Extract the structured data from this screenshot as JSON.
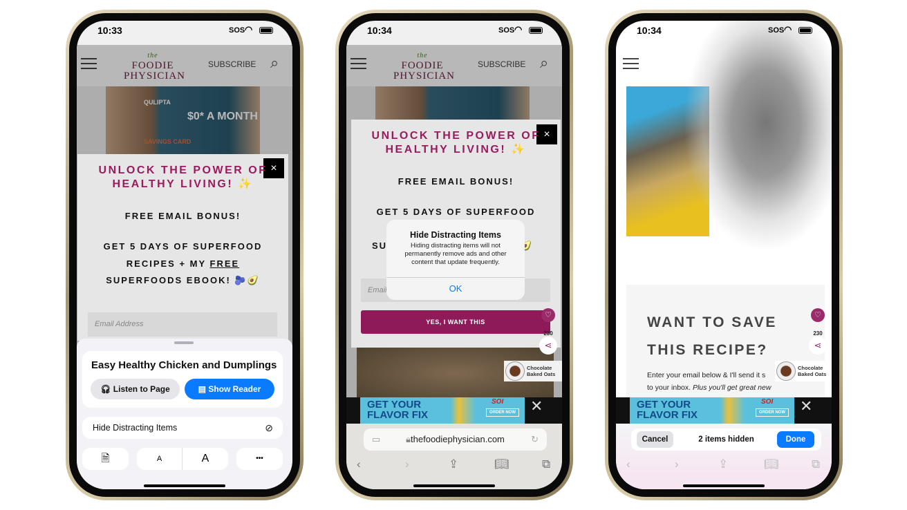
{
  "phones": [
    {
      "time": "10:33",
      "carrier": "SOS",
      "site": {
        "logo_top": "the",
        "logo_line1": "FOODIE",
        "logo_line2": "PHYSICIAN",
        "subscribe": "SUBSCRIBE"
      },
      "ad": {
        "brand": "QULIPTA",
        "price": "$0* A MONTH",
        "sub": "SAVINGS CARD"
      },
      "popup": {
        "headline1": "UNLOCK THE POWER OF",
        "headline2": "HEALTHY LIVING! ✨",
        "bonus": "FREE EMAIL BONUS!",
        "line1": "GET 5 DAYS OF SUPERFOOD",
        "line2a": "RECIPES + MY ",
        "line2b": "FREE",
        "line3": "SUPERFOODS EBOOK! 🫐🥑",
        "email_placeholder": "Email Address",
        "close": "×"
      },
      "sheet": {
        "title": "Easy Healthy Chicken and Dumplings",
        "listen": "Listen to Page",
        "reader": "Show Reader",
        "hide": "Hide Distracting Items",
        "font_small": "A",
        "font_large": "A",
        "more": "•••"
      }
    },
    {
      "time": "10:34",
      "carrier": "SOS",
      "site": {
        "logo_top": "the",
        "logo_line1": "FOODIE",
        "logo_line2": "PHYSICIAN",
        "subscribe": "SUBSCRIBE"
      },
      "popup": {
        "headline1": "UNLOCK THE POWER OF",
        "headline2": "HEALTHY LIVING! ✨",
        "bonus": "FREE EMAIL BONUS!",
        "line1": "GET 5 DAYS OF SUPERFOOD",
        "line3": "SU",
        "line3_end": "🥑",
        "email_placeholder": "Email",
        "cta": "YES, I WANT THIS",
        "close": "×"
      },
      "alert": {
        "title": "Hide Distracting Items",
        "message": "Hiding distracting items will not permanently remove ads and other content that update frequently.",
        "ok": "OK"
      },
      "share_count": "230",
      "related": {
        "line1": "Chocolate",
        "line2": "Baked Oats"
      },
      "ad": {
        "line1": "GET YOUR",
        "line2": "FLAVOR FIX",
        "brand": "SOI",
        "cta": "ORDER NOW"
      },
      "url": "thefoodiephysician.com"
    },
    {
      "time": "10:34",
      "carrier": "SOS",
      "card": {
        "title1": "WANT TO SAVE",
        "title2": "THIS RECIPE?",
        "text1": "Enter your email below & I'll send it s",
        "text2a": "to your inbox. ",
        "text2b": "Plus you'll get great new"
      },
      "share_count": "230",
      "related": {
        "line1": "Chocolate",
        "line2": "Baked Oats"
      },
      "ad": {
        "line1": "GET YOUR",
        "line2": "FLAVOR FIX",
        "brand": "SOI",
        "cta": "ORDER NOW"
      },
      "hidebar": {
        "cancel": "Cancel",
        "status": "2 items hidden",
        "done": "Done"
      }
    }
  ],
  "colors": {
    "accent": "#0a7aff",
    "brand": "#9a1a5e"
  }
}
